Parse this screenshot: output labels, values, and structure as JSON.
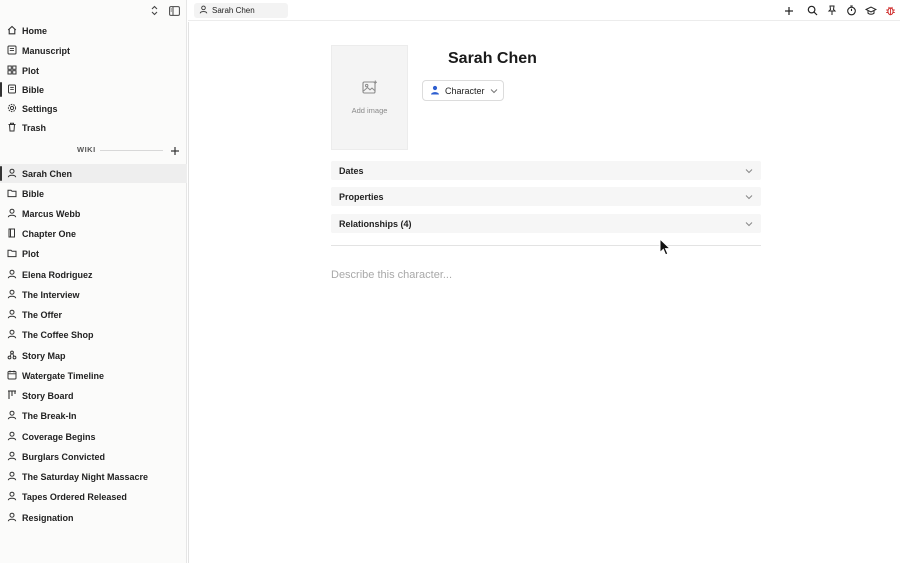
{
  "sidebar": {
    "nav": [
      {
        "label": "Home",
        "icon": "home-icon"
      },
      {
        "label": "Manuscript",
        "icon": "manuscript-icon"
      },
      {
        "label": "Plot",
        "icon": "plot-icon"
      },
      {
        "label": "Bible",
        "icon": "bible-icon"
      },
      {
        "label": "Settings",
        "icon": "settings-icon"
      },
      {
        "label": "Trash",
        "icon": "trash-icon"
      }
    ],
    "wiki_label": "WIKI",
    "wiki_items": [
      {
        "label": "Sarah Chen",
        "icon": "person-icon"
      },
      {
        "label": "Bible",
        "icon": "folder-icon"
      },
      {
        "label": "Marcus Webb",
        "icon": "person-icon"
      },
      {
        "label": "Chapter One",
        "icon": "chapter-icon"
      },
      {
        "label": "Plot",
        "icon": "folder-icon"
      },
      {
        "label": "Elena Rodriguez",
        "icon": "person-icon"
      },
      {
        "label": "The Interview",
        "icon": "person-icon"
      },
      {
        "label": "The Offer",
        "icon": "person-icon"
      },
      {
        "label": "The Coffee Shop",
        "icon": "person-icon"
      },
      {
        "label": "Story Map",
        "icon": "map-icon"
      },
      {
        "label": "Watergate Timeline",
        "icon": "timeline-icon"
      },
      {
        "label": "Story Board",
        "icon": "board-icon"
      },
      {
        "label": "The Break-In",
        "icon": "person-icon"
      },
      {
        "label": "Coverage Begins",
        "icon": "person-icon"
      },
      {
        "label": "Burglars Convicted",
        "icon": "person-icon"
      },
      {
        "label": "The Saturday Night Massacre",
        "icon": "person-icon"
      },
      {
        "label": "Tapes Ordered Released",
        "icon": "person-icon"
      },
      {
        "label": "Resignation",
        "icon": "person-icon"
      }
    ]
  },
  "tab": {
    "label": "Sarah Chen"
  },
  "entry": {
    "title": "Sarah Chen",
    "add_image_label": "Add image",
    "type_label": "Character",
    "sections": [
      {
        "label": "Dates"
      },
      {
        "label": "Properties"
      },
      {
        "label": "Relationships (4)"
      }
    ],
    "description_placeholder": "Describe this character..."
  },
  "colors": {
    "accent_blue": "#2f5fd0",
    "alert_red": "#d0302f"
  }
}
